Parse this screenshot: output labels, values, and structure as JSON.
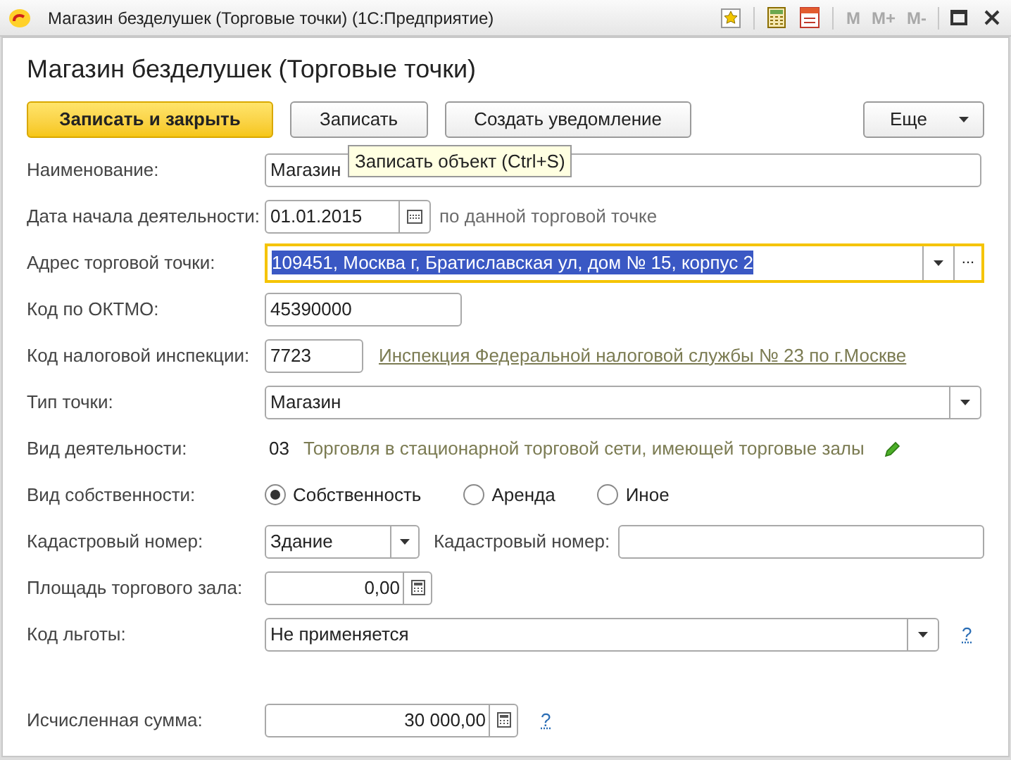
{
  "window": {
    "title": "Магазин безделушек (Торговые точки)  (1С:Предприятие)",
    "memory_buttons": [
      "M",
      "M+",
      "M-"
    ]
  },
  "heading": "Магазин безделушек (Торговые точки)",
  "toolbar": {
    "buttons": [
      {
        "label": "Записать и закрыть",
        "kind": "primary"
      },
      {
        "label": "Записать",
        "kind": "normal"
      },
      {
        "label": "Создать уведомление",
        "kind": "normal"
      }
    ],
    "more": "Еще"
  },
  "tooltip": "Записать объект (Ctrl+S)",
  "rows": [
    {
      "kind": "text",
      "label": "Наименование:",
      "value": "Магазин"
    },
    {
      "kind": "date",
      "label": "Дата начала деятельности:",
      "value": "01.01.2015",
      "note": "по данной торговой точке"
    },
    {
      "kind": "address",
      "label": "Адрес торговой точки:",
      "value": "109451, Москва г, Братиславская ул, дом № 15, корпус 2",
      "focused": true,
      "more": "..."
    },
    {
      "kind": "short",
      "label": "Код по ОКТМО:",
      "value": "45390000"
    },
    {
      "kind": "link",
      "label": "Код налоговой инспекции:",
      "value": "7723",
      "link": "Инспекция Федеральной налоговой службы № 23 по г.Москве"
    },
    {
      "kind": "select",
      "label": "Тип точки:",
      "value": "Магазин"
    },
    {
      "kind": "readonly",
      "label": "Вид деятельности:",
      "code": "03",
      "value": "Торговля в стационарной торговой сети, имеющей торговые залы"
    },
    {
      "kind": "radio",
      "label": "Вид собственности:",
      "options": [
        {
          "label": "Собственность",
          "selected": true
        },
        {
          "label": "Аренда",
          "selected": false
        },
        {
          "label": "Иное",
          "selected": false
        }
      ]
    },
    {
      "kind": "cadastre",
      "label": "Кадастровый номер:",
      "value": "Здание",
      "label2": "Кадастровый номер:"
    },
    {
      "kind": "number",
      "label": "Площадь торгового зала:",
      "value": "0,00"
    },
    {
      "kind": "select-help",
      "label": "Код льготы:",
      "value": "Не применяется",
      "help": "?"
    },
    {
      "kind": "sum",
      "label": "Исчисленная сумма:",
      "value": "30 000,00",
      "help": "?"
    }
  ]
}
